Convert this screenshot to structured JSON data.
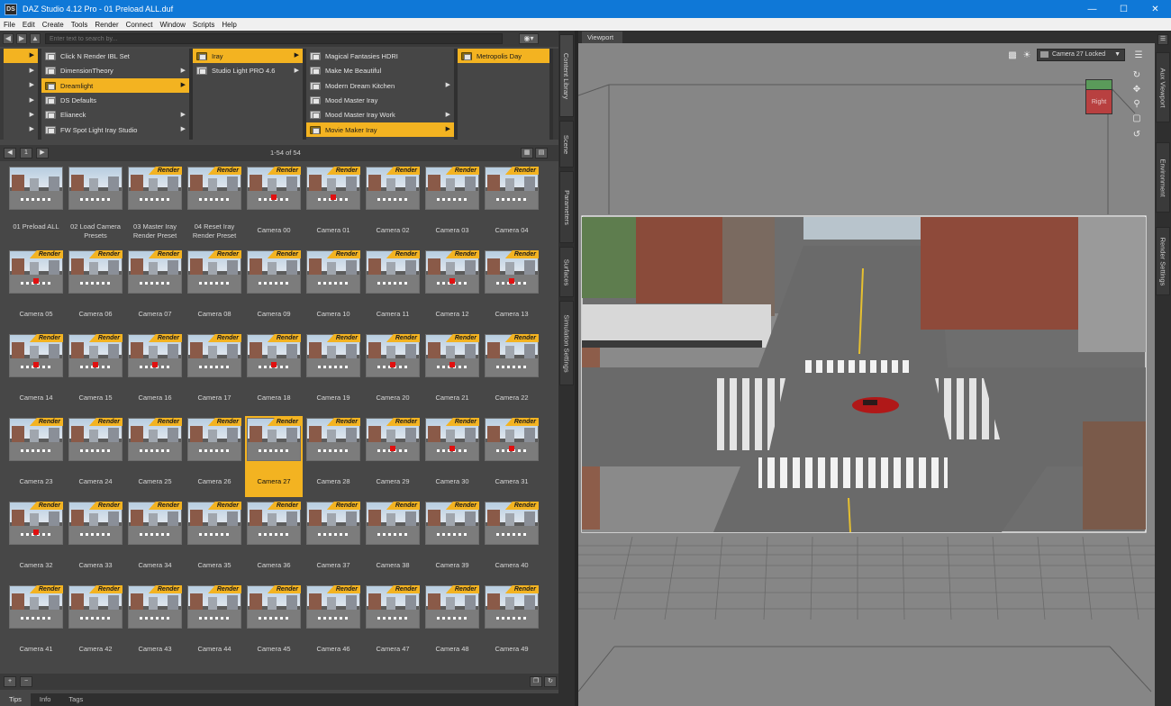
{
  "window": {
    "title": "DAZ Studio 4.12 Pro - 01 Preload ALL.duf",
    "logo": "DS",
    "buttons": [
      "minimize-icon",
      "maximize-icon",
      "close-icon"
    ]
  },
  "menubar": [
    "File",
    "Edit",
    "Create",
    "Tools",
    "Render",
    "Connect",
    "Window",
    "Scripts",
    "Help"
  ],
  "search": {
    "placeholder": "Enter text to search by..."
  },
  "browser": {
    "col1": [
      {
        "label": "",
        "selected": true
      },
      {
        "label": "",
        "selected": false
      },
      {
        "label": "",
        "selected": false
      },
      {
        "label": "",
        "selected": false
      },
      {
        "label": "",
        "selected": false
      },
      {
        "label": "",
        "selected": false
      }
    ],
    "col2": [
      {
        "label": "Click N Render IBL Set",
        "selected": false,
        "arrow": false
      },
      {
        "label": "DimensionTheory",
        "selected": false,
        "arrow": true
      },
      {
        "label": "Dreamlight",
        "selected": true,
        "arrow": true
      },
      {
        "label": "DS Defaults",
        "selected": false,
        "arrow": false
      },
      {
        "label": "Elianeck",
        "selected": false,
        "arrow": true
      },
      {
        "label": "FW Spot Light Iray Studio",
        "selected": false,
        "arrow": true
      }
    ],
    "col3": [
      {
        "label": "Iray",
        "selected": true,
        "arrow": true
      },
      {
        "label": "Studio Light PRO 4.6",
        "selected": false,
        "arrow": true
      }
    ],
    "col4": [
      {
        "label": "Magical Fantasies HDRI",
        "selected": false,
        "arrow": false
      },
      {
        "label": "Make Me Beautiful",
        "selected": false,
        "arrow": false
      },
      {
        "label": "Modern Dream Kitchen",
        "selected": false,
        "arrow": true
      },
      {
        "label": "Mood Master Iray",
        "selected": false,
        "arrow": false
      },
      {
        "label": "Mood Master Iray Work",
        "selected": false,
        "arrow": true
      },
      {
        "label": "Movie Maker Iray",
        "selected": true,
        "arrow": true
      }
    ],
    "col5": [
      {
        "label": "Metropolis Day",
        "selected": true,
        "arrow": false
      }
    ]
  },
  "pager": {
    "page": "1",
    "info": "1-54 of 54"
  },
  "badge_label": "Render",
  "presets": [
    {
      "label": "01 Preload ALL",
      "badge": false,
      "blank": false,
      "marker": false
    },
    {
      "label": "02 Load Camera Presets",
      "badge": false,
      "blank": false,
      "marker": false
    },
    {
      "label": "03 Master Iray Render Preset",
      "badge": true,
      "blank": false,
      "marker": false
    },
    {
      "label": "04 Reset Iray Render Preset",
      "badge": true,
      "blank": false,
      "marker": false
    },
    {
      "label": "Camera 00",
      "badge": true,
      "blank": false,
      "marker": true
    },
    {
      "label": "Camera 01",
      "badge": true,
      "blank": false,
      "marker": true
    },
    {
      "label": "Camera 02",
      "badge": true,
      "blank": false,
      "marker": false
    },
    {
      "label": "Camera 03",
      "badge": true,
      "blank": false,
      "marker": false
    },
    {
      "label": "Camera 04",
      "badge": true,
      "blank": false,
      "marker": false
    },
    {
      "label": "Camera 05",
      "badge": true,
      "blank": false,
      "marker": true
    },
    {
      "label": "Camera 06",
      "badge": true,
      "blank": false,
      "marker": false
    },
    {
      "label": "Camera 07",
      "badge": true,
      "blank": false,
      "marker": false
    },
    {
      "label": "Camera 08",
      "badge": true,
      "blank": false,
      "marker": false
    },
    {
      "label": "Camera 09",
      "badge": true,
      "blank": false,
      "marker": false
    },
    {
      "label": "Camera 10",
      "badge": true,
      "blank": false,
      "marker": false
    },
    {
      "label": "Camera 11",
      "badge": true,
      "blank": false,
      "marker": false
    },
    {
      "label": "Camera 12",
      "badge": true,
      "blank": false,
      "marker": true
    },
    {
      "label": "Camera 13",
      "badge": true,
      "blank": false,
      "marker": true
    },
    {
      "label": "Camera 14",
      "badge": true,
      "blank": false,
      "marker": true
    },
    {
      "label": "Camera 15",
      "badge": true,
      "blank": false,
      "marker": true
    },
    {
      "label": "Camera 16",
      "badge": true,
      "blank": false,
      "marker": true
    },
    {
      "label": "Camera 17",
      "badge": true,
      "blank": false,
      "marker": false
    },
    {
      "label": "Camera 18",
      "badge": true,
      "blank": false,
      "marker": true
    },
    {
      "label": "Camera 19",
      "badge": true,
      "blank": false,
      "marker": false
    },
    {
      "label": "Camera 20",
      "badge": true,
      "blank": false,
      "marker": true
    },
    {
      "label": "Camera 21",
      "badge": true,
      "blank": false,
      "marker": true
    },
    {
      "label": "Camera 22",
      "badge": true,
      "blank": false,
      "marker": false
    },
    {
      "label": "Camera 23",
      "badge": true,
      "blank": false,
      "marker": false
    },
    {
      "label": "Camera 24",
      "badge": true,
      "blank": false,
      "marker": false
    },
    {
      "label": "Camera 25",
      "badge": true,
      "blank": false,
      "marker": false
    },
    {
      "label": "Camera 26",
      "badge": true,
      "blank": false,
      "marker": false
    },
    {
      "label": "Camera 27",
      "badge": true,
      "blank": false,
      "marker": false,
      "selected": true
    },
    {
      "label": "Camera 28",
      "badge": true,
      "blank": false,
      "marker": false
    },
    {
      "label": "Camera 29",
      "badge": true,
      "blank": false,
      "marker": true
    },
    {
      "label": "Camera 30",
      "badge": true,
      "blank": false,
      "marker": true
    },
    {
      "label": "Camera 31",
      "badge": true,
      "blank": false,
      "marker": true
    },
    {
      "label": "Camera 32",
      "badge": true,
      "blank": false,
      "marker": true
    },
    {
      "label": "Camera 33",
      "badge": true,
      "blank": false,
      "marker": false
    },
    {
      "label": "Camera 34",
      "badge": true,
      "blank": false,
      "marker": false
    },
    {
      "label": "Camera 35",
      "badge": true,
      "blank": false,
      "marker": false
    },
    {
      "label": "Camera 36",
      "badge": true,
      "blank": false,
      "marker": false
    },
    {
      "label": "Camera 37",
      "badge": true,
      "blank": false,
      "marker": false
    },
    {
      "label": "Camera 38",
      "badge": true,
      "blank": false,
      "marker": false
    },
    {
      "label": "Camera 39",
      "badge": true,
      "blank": false,
      "marker": false
    },
    {
      "label": "Camera 40",
      "badge": true,
      "blank": false,
      "marker": false
    },
    {
      "label": "Camera 41",
      "badge": true,
      "blank": false,
      "marker": false
    },
    {
      "label": "Camera 42",
      "badge": true,
      "blank": false,
      "marker": false
    },
    {
      "label": "Camera 43",
      "badge": true,
      "blank": false,
      "marker": false
    },
    {
      "label": "Camera 44",
      "badge": true,
      "blank": false,
      "marker": false
    },
    {
      "label": "Camera 45",
      "badge": true,
      "blank": false,
      "marker": false
    },
    {
      "label": "Camera 46",
      "badge": true,
      "blank": false,
      "marker": false
    },
    {
      "label": "Camera 47",
      "badge": true,
      "blank": false,
      "marker": false
    },
    {
      "label": "Camera 48",
      "badge": true,
      "blank": false,
      "marker": false
    },
    {
      "label": "Camera 49",
      "badge": true,
      "blank": false,
      "marker": false
    }
  ],
  "bottom_tabs": [
    "Tips",
    "Info",
    "Tags"
  ],
  "side_tabs": [
    "Content Library",
    "Scene",
    "Parameters",
    "Surfaces",
    "Simulation Settings"
  ],
  "right_tabs": [
    "Aux Viewport",
    "Environment",
    "Render Settings"
  ],
  "viewport": {
    "tab": "Viewport",
    "camera": "Camera 27 Locked",
    "cube_label": "Right"
  },
  "colors": {
    "accent": "#f3b321",
    "titlebar": "#0f78d7",
    "panel": "#474747",
    "viewport_bg": "#868686"
  }
}
